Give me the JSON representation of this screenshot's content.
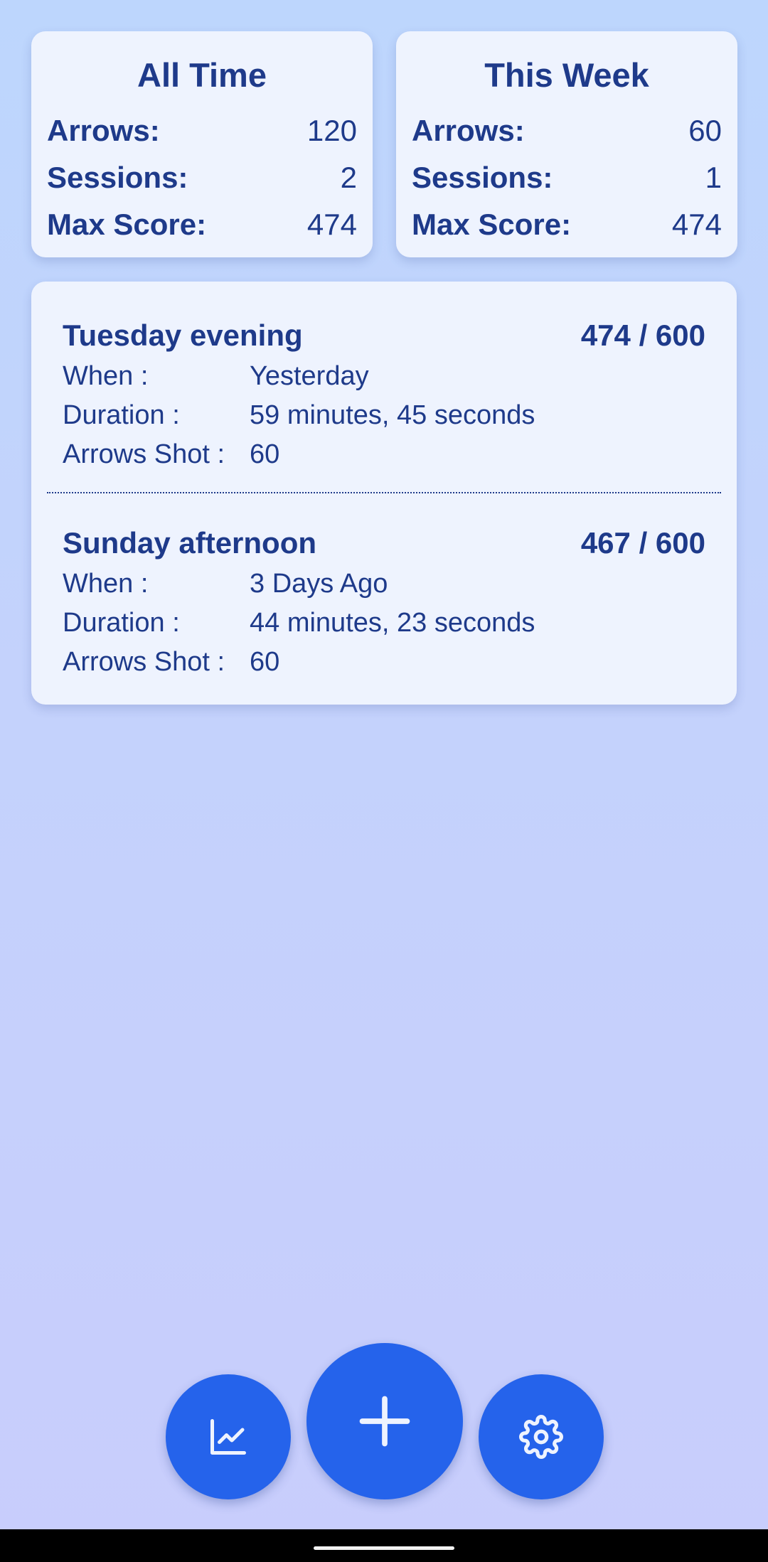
{
  "stats": {
    "all_time": {
      "title": "All Time",
      "rows": [
        {
          "label": "Arrows:",
          "value": "120"
        },
        {
          "label": "Sessions:",
          "value": "2"
        },
        {
          "label": "Max Score:",
          "value": "474"
        }
      ]
    },
    "this_week": {
      "title": "This Week",
      "rows": [
        {
          "label": "Arrows:",
          "value": "60"
        },
        {
          "label": "Sessions:",
          "value": "1"
        },
        {
          "label": "Max Score:",
          "value": "474"
        }
      ]
    }
  },
  "sessions": [
    {
      "name": "Tuesday evening",
      "score": "474 / 600",
      "when_label": "When :",
      "when": "Yesterday",
      "duration_label": "Duration :",
      "duration": "59 minutes, 45 seconds",
      "arrows_label": "Arrows Shot :",
      "arrows": "60"
    },
    {
      "name": "Sunday afternoon",
      "score": "467 / 600",
      "when_label": "When :",
      "when": "3 Days Ago",
      "duration_label": "Duration :",
      "duration": "44 minutes, 23 seconds",
      "arrows_label": "Arrows Shot :",
      "arrows": "60"
    }
  ],
  "fabs": {
    "stats_icon": "chart-line-icon",
    "add_icon": "plus-icon",
    "settings_icon": "gear-icon"
  },
  "colors": {
    "accent": "#2563eb",
    "text": "#1e3a8a",
    "card": "#eef3fe"
  }
}
